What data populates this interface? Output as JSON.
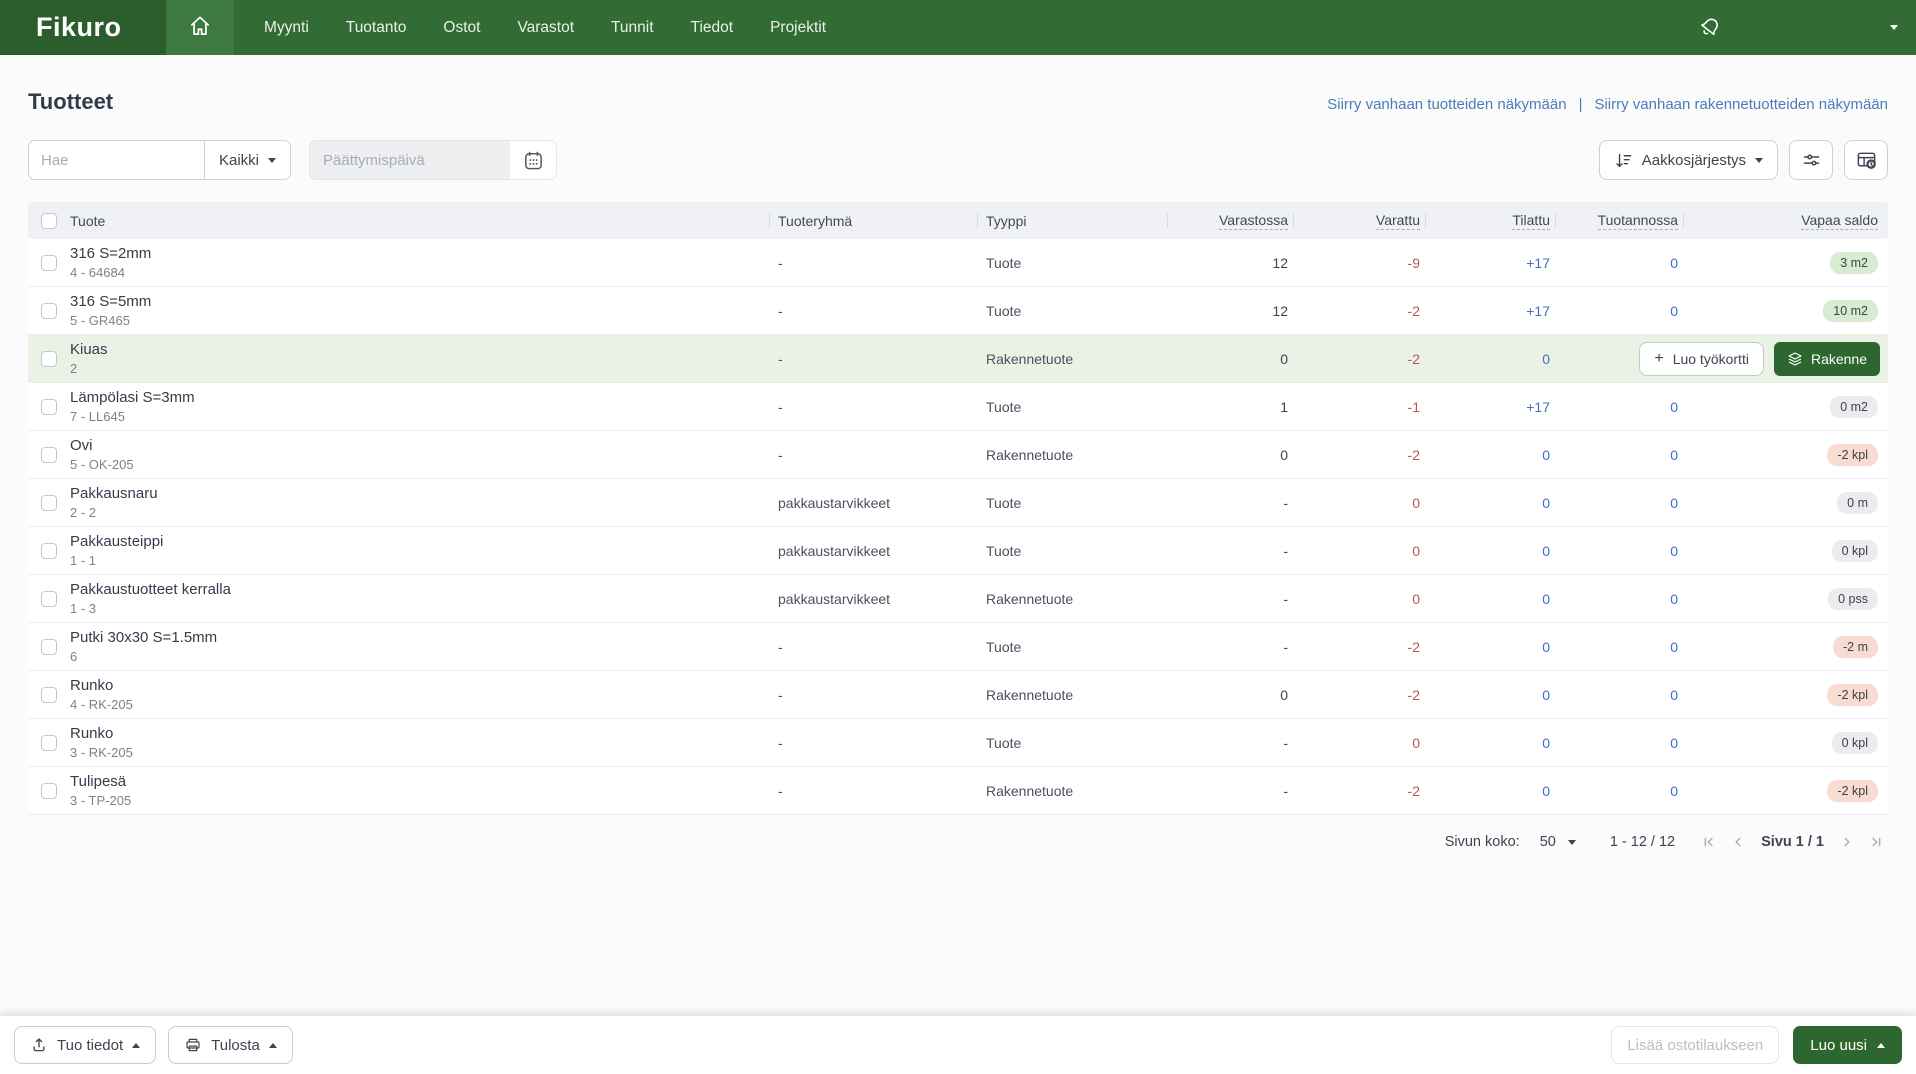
{
  "brand": {
    "logo": "Fikuro"
  },
  "navbar": {
    "items": [
      "Myynti",
      "Tuotanto",
      "Ostot",
      "Varastot",
      "Tunnit",
      "Tiedot",
      "Projektit"
    ]
  },
  "header": {
    "title": "Tuotteet",
    "links": [
      "Siirry vanhaan tuotteiden näkymään",
      "Siirry vanhaan rakennetuotteiden näkymään"
    ],
    "link_separator": "|"
  },
  "filters": {
    "search_placeholder": "Hae",
    "filter_dropdown": "Kaikki",
    "date_placeholder": "Päättymispäivä",
    "sort_button": "Aakkosjärjestys"
  },
  "table": {
    "columns": {
      "product": "Tuote",
      "group": "Tuoteryhmä",
      "type": "Tyyppi",
      "in_stock": "Varastossa",
      "reserved": "Varattu",
      "ordered": "Tilattu",
      "in_production": "Tuotannossa",
      "free_balance": "Vapaa saldo"
    },
    "row_actions": {
      "create_work_card": "Luo työkortti",
      "structure": "Rakenne"
    },
    "rows": [
      {
        "name": "316 S=2mm",
        "code": "4 - 64684",
        "group": "-",
        "type": "Tuote",
        "in_stock": "12",
        "reserved": "-9",
        "ordered": "+17",
        "in_production": "0",
        "free_balance": "3 m2",
        "balance_state": "positive",
        "hovered": false
      },
      {
        "name": "316 S=5mm",
        "code": "5 - GR465",
        "group": "-",
        "type": "Tuote",
        "in_stock": "12",
        "reserved": "-2",
        "ordered": "+17",
        "in_production": "0",
        "free_balance": "10 m2",
        "balance_state": "positive",
        "hovered": false
      },
      {
        "name": "Kiuas",
        "code": "2",
        "group": "-",
        "type": "Rakennetuote",
        "in_stock": "0",
        "reserved": "-2",
        "ordered": "0",
        "in_production": "",
        "free_balance": "",
        "balance_state": "",
        "hovered": true
      },
      {
        "name": "Lämpölasi S=3mm",
        "code": "7 - LL645",
        "group": "-",
        "type": "Tuote",
        "in_stock": "1",
        "reserved": "-1",
        "ordered": "+17",
        "in_production": "0",
        "free_balance": "0 m2",
        "balance_state": "neutral",
        "hovered": false
      },
      {
        "name": "Ovi",
        "code": "5 - OK-205",
        "group": "-",
        "type": "Rakennetuote",
        "in_stock": "0",
        "reserved": "-2",
        "ordered": "0",
        "in_production": "0",
        "free_balance": "-2 kpl",
        "balance_state": "negative",
        "hovered": false
      },
      {
        "name": "Pakkausnaru",
        "code": "2 - 2",
        "group": "pakkaustarvikkeet",
        "type": "Tuote",
        "in_stock": "-",
        "reserved": "0",
        "ordered": "0",
        "in_production": "0",
        "free_balance": "0 m",
        "balance_state": "neutral",
        "hovered": false
      },
      {
        "name": "Pakkausteippi",
        "code": "1 - 1",
        "group": "pakkaustarvikkeet",
        "type": "Tuote",
        "in_stock": "-",
        "reserved": "0",
        "ordered": "0",
        "in_production": "0",
        "free_balance": "0 kpl",
        "balance_state": "neutral",
        "hovered": false
      },
      {
        "name": "Pakkaustuotteet kerralla",
        "code": "1 - 3",
        "group": "pakkaustarvikkeet",
        "type": "Rakennetuote",
        "in_stock": "-",
        "reserved": "0",
        "ordered": "0",
        "in_production": "0",
        "free_balance": "0 pss",
        "balance_state": "neutral",
        "hovered": false
      },
      {
        "name": "Putki 30x30 S=1.5mm",
        "code": "6",
        "group": "-",
        "type": "Tuote",
        "in_stock": "-",
        "reserved": "-2",
        "ordered": "0",
        "in_production": "0",
        "free_balance": "-2 m",
        "balance_state": "negative",
        "hovered": false
      },
      {
        "name": "Runko",
        "code": "4 - RK-205",
        "group": "-",
        "type": "Rakennetuote",
        "in_stock": "0",
        "reserved": "-2",
        "ordered": "0",
        "in_production": "0",
        "free_balance": "-2 kpl",
        "balance_state": "negative",
        "hovered": false
      },
      {
        "name": "Runko",
        "code": "3 - RK-205",
        "group": "-",
        "type": "Tuote",
        "in_stock": "-",
        "reserved": "0",
        "ordered": "0",
        "in_production": "0",
        "free_balance": "0 kpl",
        "balance_state": "neutral",
        "hovered": false
      },
      {
        "name": "Tulipesä",
        "code": "3 - TP-205",
        "group": "-",
        "type": "Rakennetuote",
        "in_stock": "-",
        "reserved": "-2",
        "ordered": "0",
        "in_production": "0",
        "free_balance": "-2 kpl",
        "balance_state": "negative",
        "hovered": false
      }
    ]
  },
  "pagination": {
    "page_size_label": "Sivun koko:",
    "page_size": "50",
    "range": "1 - 12 / 12",
    "page_label": "Sivu 1 / 1"
  },
  "footer": {
    "import_button": "Tuo tiedot",
    "print_button": "Tulosta",
    "add_to_purchase_order_button": "Lisää ostotilaukseen",
    "create_new_button": "Luo uusi"
  },
  "colors": {
    "navbar_green": "#326b33",
    "accent_green": "#2d662e",
    "link_blue": "#4a7cba",
    "value_blue": "#4273b5",
    "value_red": "#bb5752",
    "row_hover_green": "#eaf2e6",
    "pill_green_bg": "#d9ecd1",
    "pill_gray_bg": "#ececee",
    "pill_red_bg": "#f8dbd3"
  },
  "icons": {
    "home": "house-outline",
    "notifications": "bell",
    "user_menu": "caret-down",
    "calendar": "calendar-dots",
    "sort": "arrow-down-lines",
    "filter": "sliders",
    "columns": "table-clock",
    "create": "plus",
    "structure": "layers",
    "import": "upload-arrow",
    "print": "printer"
  }
}
